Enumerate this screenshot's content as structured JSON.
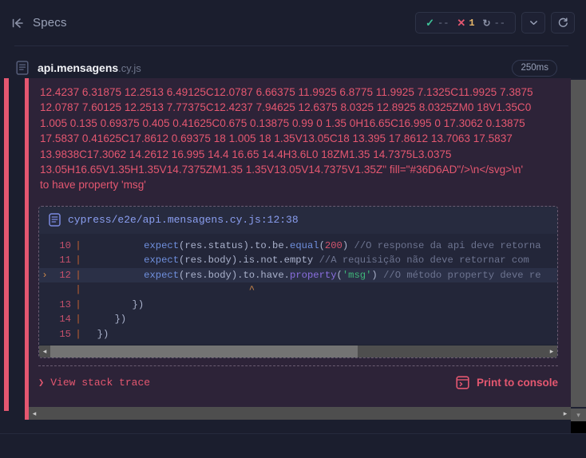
{
  "colors": {
    "bg": "#1b1e2e",
    "error_accent": "#e45770",
    "pass": "#3ec298",
    "fail": "#e45770",
    "link": "#8a9ef0",
    "code_bg": "#232639",
    "error_panel_bg": "#2d2338"
  },
  "topbar": {
    "back_icon": "arrow-left-to-line-icon",
    "back_label": "Specs",
    "stats": [
      {
        "name": "passed",
        "glyph": "✓",
        "value": "--"
      },
      {
        "name": "failed",
        "glyph": "✕",
        "value": "1"
      },
      {
        "name": "pending",
        "glyph": "↻",
        "value": "--"
      }
    ],
    "chevron_button": "chevron-down-icon",
    "reload_button": "reload-icon"
  },
  "spec": {
    "icon": "file-document-icon",
    "name": "api.mensagens",
    "ext": ".cy.js",
    "duration": "250ms"
  },
  "error": {
    "message": "12.4237 6.31875 12.2513 6.49125C12.0787 6.66375 11.9925 6.8775 11.9925 7.1325C11.9925 7.3875 12.0787 7.60125 12.2513 7.77375C12.4237 7.94625 12.6375 8.0325 12.8925 8.0325ZM0 18V1.35C0 1.005 0.135 0.69375 0.405 0.41625C0.675 0.13875 0.99 0 1.35 0H16.65C16.995 0 17.3062 0.13875 17.5837 0.41625C17.8612 0.69375 18 1.005 18 1.35V13.05C18 13.395 17.8612 13.7063 17.5837 13.9838C17.3062 14.2612 16.995 14.4 16.65 14.4H3.6L0 18ZM1.35 14.7375L3.0375 13.05H16.65V1.35H1.35V14.7375ZM1.35 1.35V13.05V14.7375V1.35Z\" fill=\"#36D6AD\"/>\\n</svg>\\n'\nto have property 'msg'",
    "code_frame": {
      "icon": "file-document-icon",
      "path": "cypress/e2e/api.mensagens.cy.js:12:38",
      "lines": [
        {
          "no": "10",
          "highlighted": false,
          "marker": "",
          "tokens": [
            {
              "t": "          ",
              "c": "t-pun"
            },
            {
              "t": "expect",
              "c": "t-fn"
            },
            {
              "t": "(res.status).to.be.",
              "c": "t-pun"
            },
            {
              "t": "equal",
              "c": "t-fn"
            },
            {
              "t": "(",
              "c": "t-pun"
            },
            {
              "t": "200",
              "c": "t-num"
            },
            {
              "t": ")",
              "c": "t-pun"
            },
            {
              "t": " //O response da api deve retorna",
              "c": "t-com"
            }
          ]
        },
        {
          "no": "11",
          "highlighted": false,
          "marker": "",
          "tokens": [
            {
              "t": "          ",
              "c": "t-pun"
            },
            {
              "t": "expect",
              "c": "t-fn"
            },
            {
              "t": "(res.body).is.not.empty",
              "c": "t-pun"
            },
            {
              "t": " //A requisição não deve retornar com ",
              "c": "t-com"
            }
          ]
        },
        {
          "no": "12",
          "highlighted": true,
          "marker": "›",
          "tokens": [
            {
              "t": "          ",
              "c": "t-pun"
            },
            {
              "t": "expect",
              "c": "t-fn"
            },
            {
              "t": "(res.body).to.have.",
              "c": "t-pun"
            },
            {
              "t": "property",
              "c": "t-prop"
            },
            {
              "t": "(",
              "c": "t-pun"
            },
            {
              "t": "'msg'",
              "c": "t-str"
            },
            {
              "t": ")",
              "c": "t-pun"
            },
            {
              "t": " //O método property deve re",
              "c": "t-com"
            }
          ]
        },
        {
          "no": "",
          "highlighted": false,
          "marker": "",
          "caret": "^",
          "tokens": []
        },
        {
          "no": "13",
          "highlighted": false,
          "marker": "",
          "tokens": [
            {
              "t": "        })",
              "c": "t-pun"
            }
          ]
        },
        {
          "no": "14",
          "highlighted": false,
          "marker": "",
          "tokens": [
            {
              "t": "     })",
              "c": "t-pun"
            }
          ]
        },
        {
          "no": "15",
          "highlighted": false,
          "marker": "",
          "tokens": [
            {
              "t": "  })",
              "c": "t-pun"
            }
          ]
        }
      ]
    },
    "footer": {
      "stack_chevron": "chevron-right-icon",
      "stack_label": "View stack trace",
      "print_icon": "console-icon",
      "print_label": "Print to console"
    }
  },
  "scrollbars": {
    "left_arrow": "◂",
    "right_arrow": "▸",
    "down_arrow": "▾"
  }
}
